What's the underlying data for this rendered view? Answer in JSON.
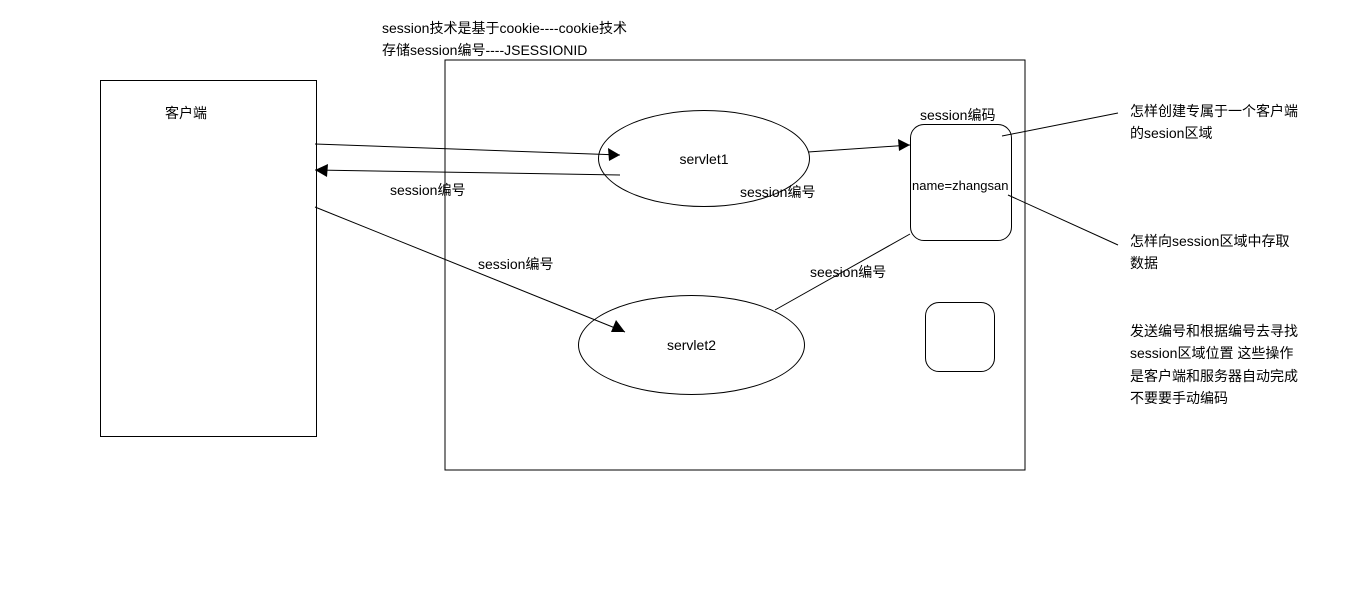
{
  "title": {
    "line1": "session技术是基于cookie----cookie技术",
    "line2": "存储session编号----JSESSIONID"
  },
  "client_label": "客户端",
  "servlet1_label": "servlet1",
  "servlet2_label": "servlet2",
  "session_area": {
    "header": "session编码",
    "value": "name=zhangsan"
  },
  "labels": {
    "session_no_resp": "session编号",
    "session_no_s1_to_area": "session编号",
    "session_no_req2": "session编号",
    "seesion_no_s2_to_area": "seesion编号"
  },
  "notes": {
    "note1": "怎样创建专属于一个客户端的sesion区域",
    "note2": "怎样向session区域中存取数据",
    "note3": "发送编号和根据编号去寻找session区域位置 这些操作是客户端和服务器自动完成 不要要手动编码"
  }
}
